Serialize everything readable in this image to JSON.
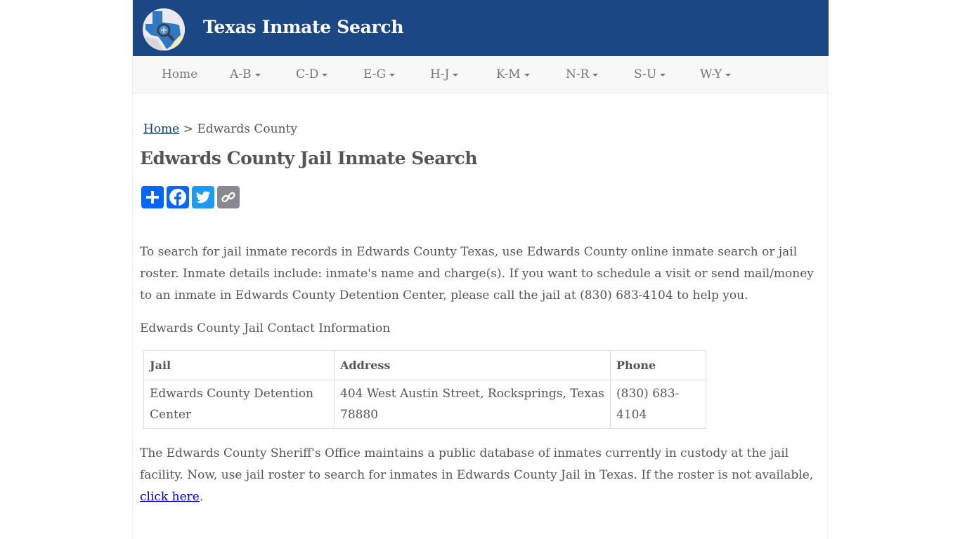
{
  "header": {
    "site_title": "Texas Inmate Search",
    "logo_icon": "texas-map-magnifier-logo",
    "background_color": "#1c4785"
  },
  "nav": {
    "items": [
      {
        "label": "Home",
        "has_dropdown": false
      },
      {
        "label": "A-B",
        "has_dropdown": true
      },
      {
        "label": "C-D",
        "has_dropdown": true
      },
      {
        "label": "E-G",
        "has_dropdown": true
      },
      {
        "label": "H-J",
        "has_dropdown": true
      },
      {
        "label": "K-M",
        "has_dropdown": true
      },
      {
        "label": "N-R",
        "has_dropdown": true
      },
      {
        "label": "S-U",
        "has_dropdown": true
      },
      {
        "label": "W-Y",
        "has_dropdown": true
      }
    ]
  },
  "breadcrumb": {
    "home": "Home",
    "separator": " > ",
    "current": "Edwards County"
  },
  "page_title": "Edwards County Jail Inmate Search",
  "share": {
    "buttons": [
      {
        "name": "share",
        "icon": "plus-icon",
        "color": "#0166ff"
      },
      {
        "name": "facebook",
        "icon": "facebook-icon",
        "color": "#0866ff"
      },
      {
        "name": "twitter",
        "icon": "twitter-icon",
        "color": "#1d9bf0"
      },
      {
        "name": "copy-link",
        "icon": "link-icon",
        "color": "#888990"
      }
    ]
  },
  "intro_paragraph": "To search for jail inmate records in Edwards County Texas, use Edwards County online inmate search or jail roster. Inmate details include: inmate's name and charge(s). If you want to schedule a visit or send mail/money to an inmate in Edwards County Detention Center, please call the jail at (830) 683-4104 to help you.",
  "contact_heading": "Edwards County Jail Contact Information",
  "table": {
    "headers": [
      "Jail",
      "Address",
      "Phone"
    ],
    "rows": [
      [
        "Edwards County Detention Center",
        "404 West Austin Street, Rocksprings, Texas 78880",
        "(830) 683-4104"
      ]
    ]
  },
  "closing_paragraph": {
    "text": "The Edwards County Sheriff's Office maintains a public database of inmates currently in custody at the jail facility. Now, use jail roster to search for inmates in Edwards County Jail in Texas. If the roster is not available, ",
    "link": "click here",
    "end": "."
  }
}
